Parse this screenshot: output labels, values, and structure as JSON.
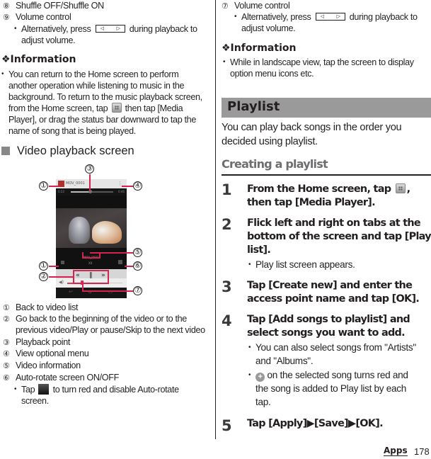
{
  "left": {
    "item8": {
      "num": "⑧",
      "text": "Shuffle OFF/Shuffle ON"
    },
    "item9": {
      "num": "⑨",
      "text": "Volume control"
    },
    "item9_note_pre": "Alternatively, press",
    "item9_note_post": "during playback to",
    "item9_note_line2": "adjust volume.",
    "info_heading": "❖Information",
    "info_lines": [
      "You can return to the Home screen to perform",
      "another operation while listening to music in the",
      "background. To return to the music playback screen,",
      "from the Home screen, tap",
      "then tap [Media",
      "Player], or drag the status bar downward to tap the",
      "name of song that is being played."
    ],
    "section_heading": "Video playback screen",
    "legend": [
      {
        "num": "①",
        "text": "Back to video list"
      },
      {
        "num": "②",
        "text": "Go back to the beginning of the video or to the"
      },
      {
        "num": "",
        "text": "previous video/Play or pause/Skip to the next video"
      },
      {
        "num": "③",
        "text": "Playback point"
      },
      {
        "num": "④",
        "text": "View optional menu"
      },
      {
        "num": "⑤",
        "text": "Video information"
      },
      {
        "num": "⑥",
        "text": "Auto-rotate screen ON/OFF"
      }
    ],
    "item6_note_pre": "Tap",
    "item6_note_post": "to turn red and disable Auto-rotate",
    "item6_note_line2": "screen."
  },
  "phone": {
    "video_title": "MOV_0001",
    "elapsed": "0:22",
    "duration": "0:46",
    "info_title": "MOV_0001",
    "info_sub": "XX",
    "playback_progress": 0.45,
    "volume_level": 0.27,
    "callouts": [
      "①",
      "②",
      "③",
      "④",
      "⑤",
      "⑥",
      "⑦"
    ],
    "icons": {
      "rewind": "«",
      "pause": "‖",
      "forward": "»",
      "speaker": "◀)",
      "back": "↩",
      "home": "⌂",
      "recent": "▭",
      "menu": "⋮"
    }
  },
  "right": {
    "item7": {
      "num": "⑦",
      "text": "Volume control"
    },
    "item7_note_pre": "Alternatively, press",
    "item7_note_post": "during playback to",
    "item7_note_line2": "adjust volume.",
    "info_heading": "❖Information",
    "info_line1": "While in landscape view, tap the screen to display",
    "info_line2": "option menu icons etc.",
    "playlist_heading": "Playlist",
    "intro_line1": "You can play back songs in the order you",
    "intro_line2": "decided using playlist.",
    "sub_heading": "Creating a playlist",
    "steps": [
      {
        "n": "1",
        "line1_pre": "From the Home screen, tap",
        "line1_post": ",",
        "line2": "then tap [Media Player]."
      },
      {
        "n": "2",
        "line1": "Flick left and right on tabs at the",
        "line2": "bottom of the screen and tap [Play",
        "line3": "list].",
        "note": "Play list screen appears."
      },
      {
        "n": "3",
        "line1": "Tap [Create new] and enter the",
        "line2": "access point name and tap [OK]."
      },
      {
        "n": "4",
        "line1": "Tap [Add songs to playlist] and",
        "line2": "select songs you want to add.",
        "note1_l1": "You can also select songs from \"Artists\"",
        "note1_l2": "and \"Albums\".",
        "note2_l1": "on the selected song turns red and",
        "note2_l2": "the song is added to Play list by each",
        "note2_l3": "tap."
      },
      {
        "n": "5",
        "line1": "Tap [Apply]▶[Save]▶[OK]."
      }
    ]
  },
  "footer": {
    "section": "Apps",
    "page": "178"
  }
}
